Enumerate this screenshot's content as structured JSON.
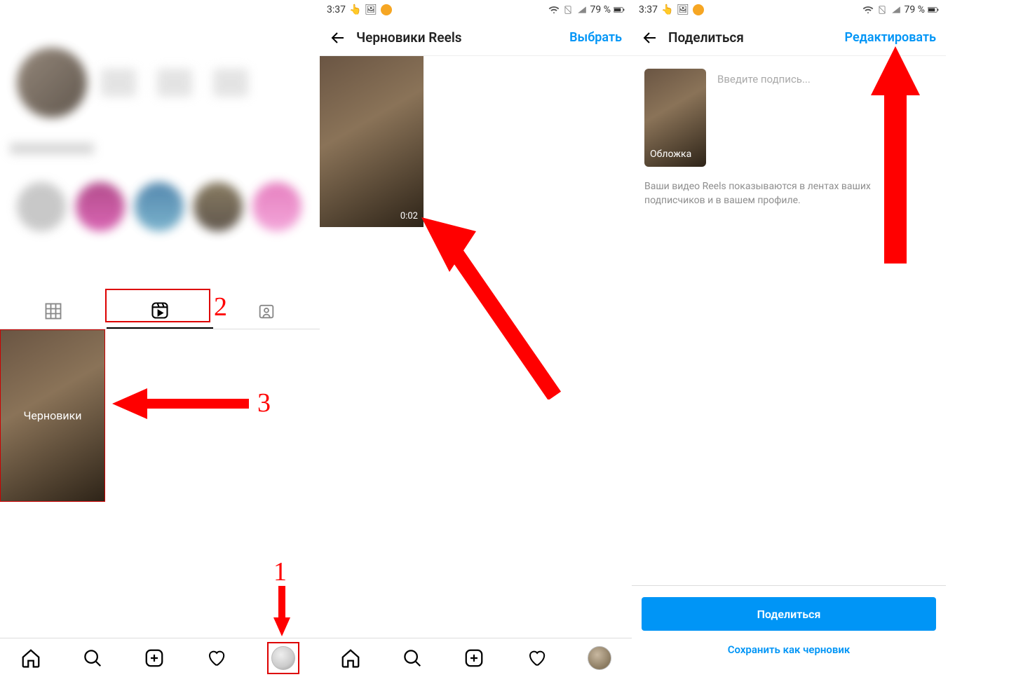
{
  "status": {
    "time": "3:37",
    "battery": "79 %"
  },
  "panel1": {
    "tabs": {
      "grid": "grid",
      "reels": "reels",
      "tagged": "tagged"
    },
    "draft_label": "Черновики",
    "nav": {
      "home": "home",
      "search": "search",
      "add": "add",
      "like": "like",
      "profile": "profile"
    }
  },
  "panel2": {
    "title": "Черновики Reels",
    "action": "Выбрать",
    "duration": "0:02"
  },
  "panel3": {
    "title": "Поделиться",
    "action": "Редактировать",
    "cover": "Обложка",
    "caption_placeholder": "Введите подпись...",
    "info": "Ваши видео Reels показываются в лентах ваших подписчиков и в вашем профиле.",
    "share_btn": "Поделиться",
    "save_draft": "Сохранить как черновик"
  },
  "annotations": {
    "n1": "1",
    "n2": "2",
    "n3": "3"
  }
}
